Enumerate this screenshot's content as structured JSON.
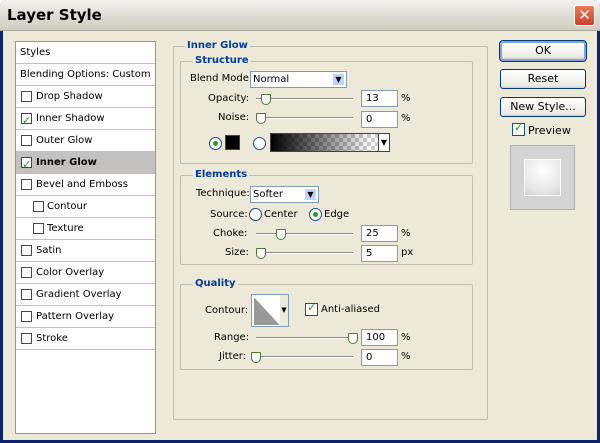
{
  "window": {
    "title": "Layer Style",
    "close_glyph": "✕"
  },
  "styles_list": {
    "items": [
      {
        "label": "Styles",
        "type": "head"
      },
      {
        "label": "Blending Options: Custom",
        "type": "head"
      },
      {
        "label": "Drop Shadow",
        "checked": false
      },
      {
        "label": "Inner Shadow",
        "checked": true
      },
      {
        "label": "Outer Glow",
        "checked": false
      },
      {
        "label": "Inner Glow",
        "checked": true,
        "selected": true
      },
      {
        "label": "Bevel and Emboss",
        "checked": false
      },
      {
        "label": "Contour",
        "checked": false,
        "sub": true
      },
      {
        "label": "Texture",
        "checked": false,
        "sub": true
      },
      {
        "label": "Satin",
        "checked": false
      },
      {
        "label": "Color Overlay",
        "checked": false
      },
      {
        "label": "Gradient Overlay",
        "checked": false
      },
      {
        "label": "Pattern Overlay",
        "checked": false
      },
      {
        "label": "Stroke",
        "checked": false
      }
    ]
  },
  "panel": {
    "title": "Inner Glow",
    "structure": {
      "title": "Structure",
      "blend_mode_label": "Blend Mode:",
      "blend_mode_value": "Normal",
      "opacity_label": "Opacity:",
      "opacity_value": "13",
      "noise_label": "Noise:",
      "noise_value": "0",
      "percent": "%"
    },
    "elements": {
      "title": "Elements",
      "technique_label": "Technique:",
      "technique_value": "Softer",
      "source_label": "Source:",
      "center_label": "Center",
      "edge_label": "Edge",
      "choke_label": "Choke:",
      "choke_value": "25",
      "size_label": "Size:",
      "size_value": "5",
      "px": "px"
    },
    "quality": {
      "title": "Quality",
      "contour_label": "Contour:",
      "anti_aliased_label": "Anti-aliased",
      "range_label": "Range:",
      "range_value": "100",
      "jitter_label": "Jitter:",
      "jitter_value": "0"
    }
  },
  "buttons": {
    "ok": "OK",
    "reset": "Reset",
    "new_style": "New Style...",
    "preview_label": "Preview"
  }
}
